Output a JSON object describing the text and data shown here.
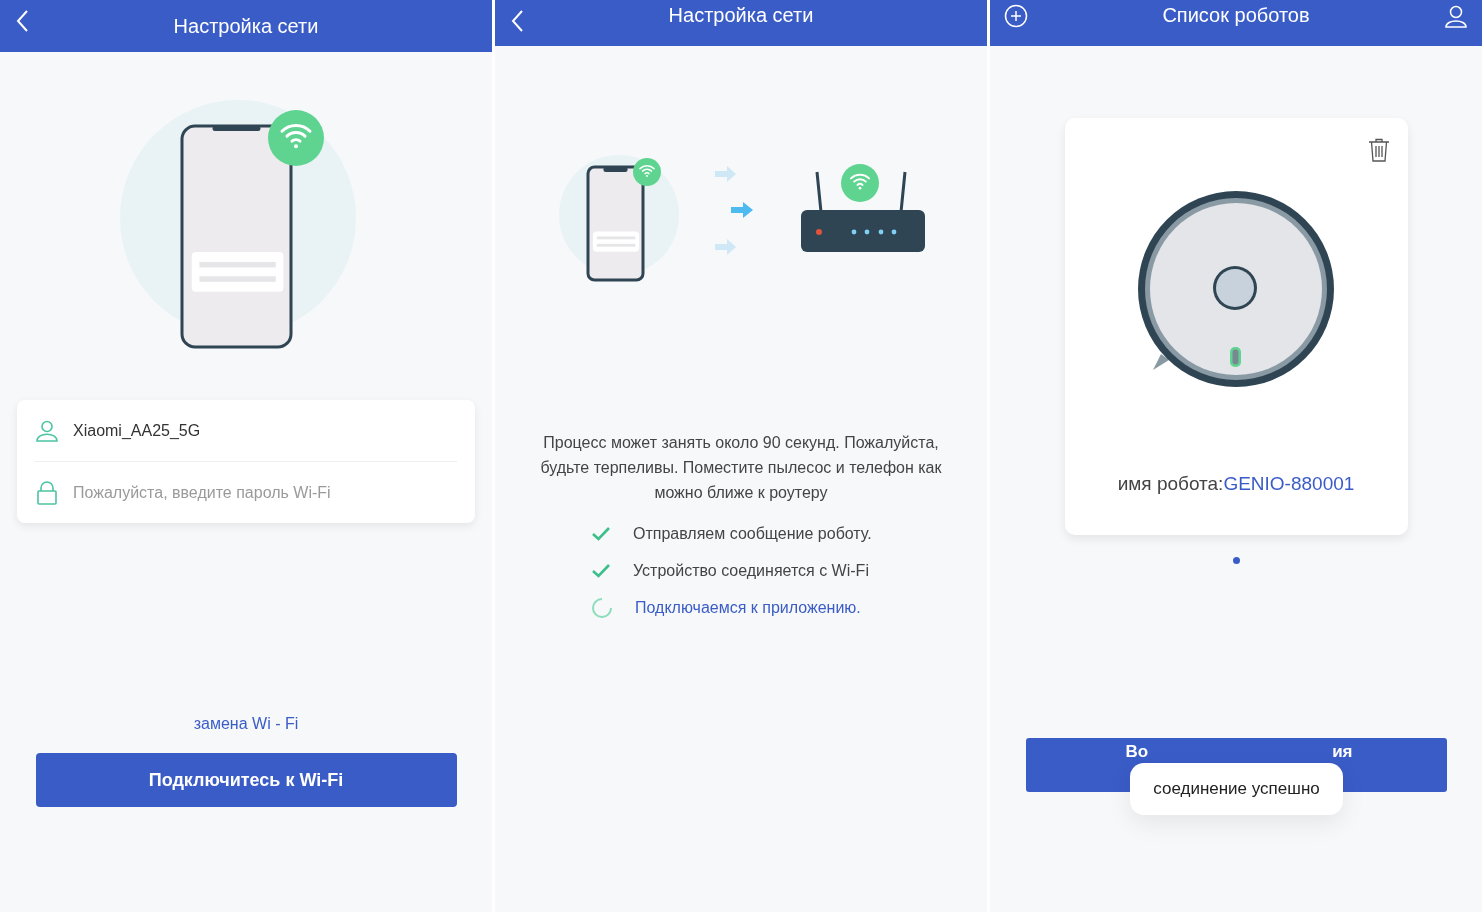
{
  "screens": [
    {
      "kind": "wifi_form",
      "header": {
        "title": "Настройка сети"
      },
      "form": {
        "ssid": "Xiaomi_AA25_5G",
        "password_placeholder": "Пожалуйста, введите пароль Wi-Fi"
      },
      "link": "замена Wi - Fi",
      "button": "Подключитесь к Wi-Fi"
    },
    {
      "kind": "progress",
      "header": {
        "title": "Настройка сети"
      },
      "message": "Процесс может занять около 90 секунд. Пожалуйста, будьте терпеливы. Поместите пылесос и телефон как можно ближе к роутеру",
      "steps": [
        {
          "label": "Отправляем сообщение роботу.",
          "done": true
        },
        {
          "label": "Устройство соединяется с Wi-Fi",
          "done": true
        },
        {
          "label": "Подключаемся к приложению.",
          "done": false
        }
      ]
    },
    {
      "kind": "robot_list",
      "header": {
        "title": "Список роботов"
      },
      "robot": {
        "label": "имя робота:",
        "name": "GENIO-880001"
      },
      "pager": [
        {
          "selected": true
        }
      ],
      "button_parts": [
        "Во",
        "ия"
      ],
      "toast": "соединение успешно"
    }
  ]
}
